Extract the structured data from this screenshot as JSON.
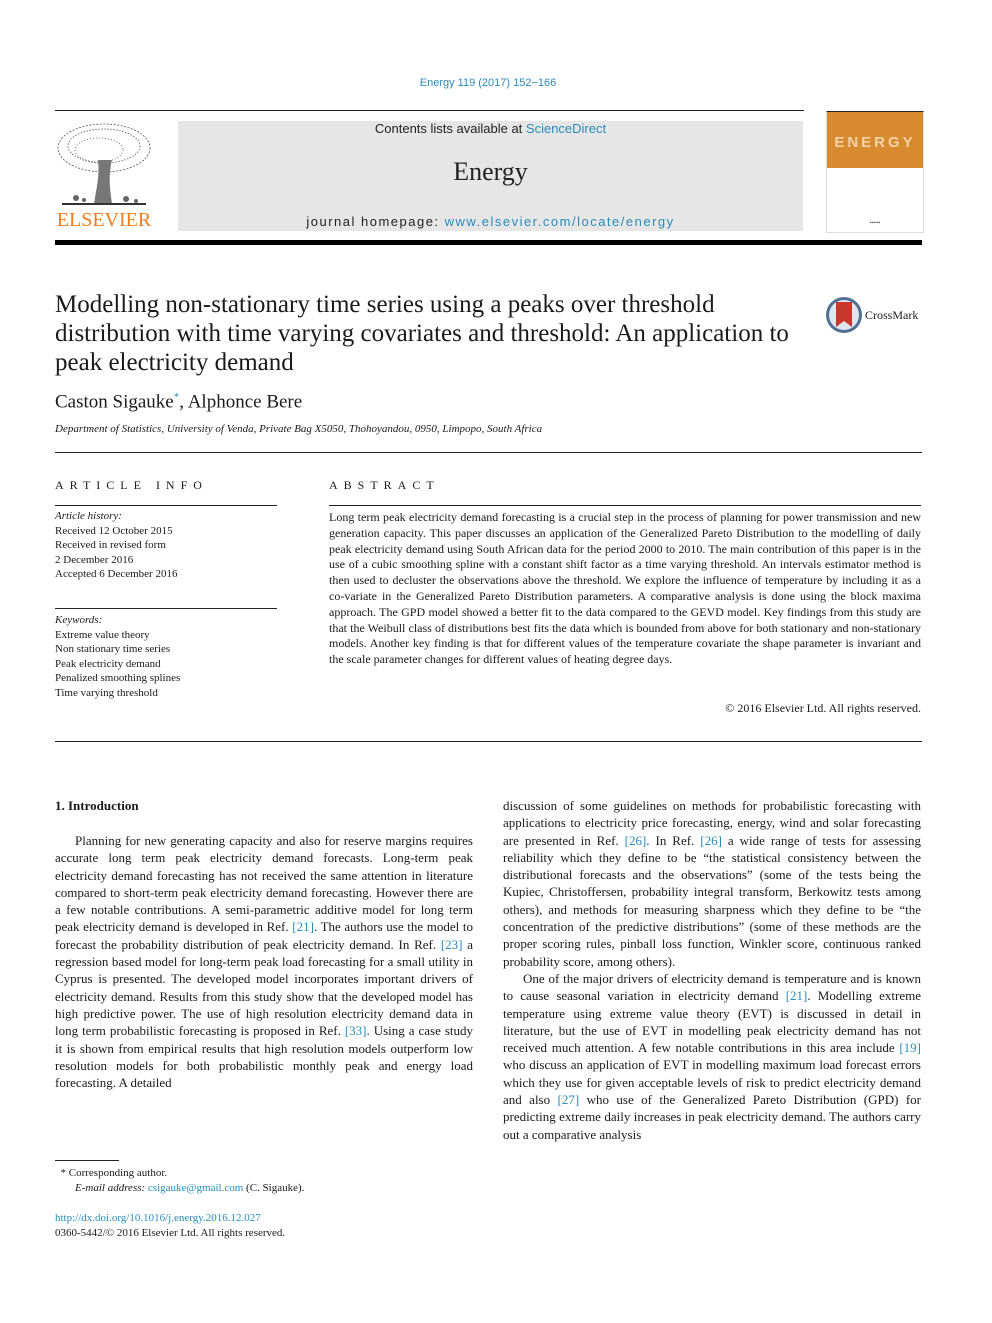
{
  "header": {
    "citation": "Energy 119 (2017) 152−166",
    "contents_prefix": "Contents lists available at ",
    "contents_link": "ScienceDirect",
    "journal_name": "Energy",
    "homepage_prefix": "journal homepage: ",
    "homepage_link": "www.elsevier.com/locate/energy",
    "publisher_logo": "ELSEVIER",
    "cover_title": "ENERGY",
    "crossmark_label": "CrossMark",
    "colors": {
      "link": "#2a8bb8",
      "elsevier_orange": "#f07d1b",
      "cover_orange": "#d88a2e",
      "banner_gray": "#e6e6e6"
    }
  },
  "article": {
    "title": "Modelling non-stationary time series using a peaks over threshold distribution with time varying covariates and threshold: An application to peak electricity demand",
    "author1": "Caston Sigauke",
    "author1_mark": "*",
    "author_sep": ", ",
    "author2": "Alphonce Bere",
    "affiliation": "Department of Statistics, University of Venda, Private Bag X5050, Thohoyandou, 0950, Limpopo, South Africa"
  },
  "article_info": {
    "heading": "ARTICLE INFO",
    "history_label": "Article history:",
    "history": [
      "Received 12 October 2015",
      "Received in revised form",
      "2 December 2016",
      "Accepted 6 December 2016"
    ],
    "keywords_label": "Keywords:",
    "keywords": [
      "Extreme value theory",
      "Non stationary time series",
      "Peak electricity demand",
      "Penalized smoothing splines",
      "Time varying threshold"
    ]
  },
  "abstract": {
    "heading": "ABSTRACT",
    "text": "Long term peak electricity demand forecasting is a crucial step in the process of planning for power transmission and new generation capacity. This paper discusses an application of the Generalized Pareto Distribution to the modelling of daily peak electricity demand using South African data for the period 2000 to 2010. The main contribution of this paper is in the use of a cubic smoothing spline with a constant shift factor as a time varying threshold. An intervals estimator method is then used to decluster the observations above the threshold. We explore the influence of temperature by including it as a co-variate in the Generalized Pareto Distribution parameters. A comparative analysis is done using the block maxima approach. The GPD model showed a better fit to the data compared to the GEVD model. Key findings from this study are that the Weibull class of distributions best fits the data which is bounded from above for both stationary and non-stationary models. Another key finding is that for different values of the temperature covariate the shape parameter is invariant and the scale parameter changes for different values of heating degree days.",
    "copyright": "© 2016 Elsevier Ltd. All rights reserved."
  },
  "introduction": {
    "heading": "1.  Introduction",
    "left_p1_a": "Planning for new generating capacity and also for reserve margins requires accurate long term peak electricity demand forecasts. Long-term peak electricity demand forecasting has not received the same attention in literature compared to short-term peak electricity demand forecasting. However there are a few notable contributions. A semi-parametric additive model for long term peak electricity demand is developed in Ref. ",
    "ref21": "[21]",
    "left_p1_b": ". The authors use the model to forecast the probability distribution of peak electricity demand. In Ref. ",
    "ref23": "[23]",
    "left_p1_c": " a regression based model for long-term peak load forecasting for a small utility in Cyprus is presented. The developed model incorporates important drivers of electricity demand. Results from this study show that the developed model has high predictive power. The use of high resolution electricity demand data in long term probabilistic forecasting is proposed in Ref. ",
    "ref33": "[33]",
    "left_p1_d": ". Using a case study it is shown from empirical results that high resolution models outperform low resolution models for both probabilistic monthly peak and energy load forecasting. A detailed",
    "right_p1_a": "discussion of some guidelines on methods for probabilistic forecasting with applications to electricity price forecasting, energy, wind and solar forecasting are presented in Ref. ",
    "ref26a": "[26]",
    "right_p1_b": ". In Ref. ",
    "ref26b": "[26]",
    "right_p1_c": " a wide range of tests for assessing reliability which they define to be “the statistical consistency between the distributional forecasts and the observations” (some of the tests being the Kupiec, Christoffersen, probability integral transform, Berkowitz tests among others), and methods for measuring sharpness which they define to be “the concentration of the predictive distributions” (some of these methods are the proper scoring rules, pinball loss function, Winkler score, continuous ranked probability score, among others).",
    "right_p2_a": "One of the major drivers of electricity demand is temperature and is known to cause seasonal variation in electricity demand ",
    "ref21b": "[21]",
    "right_p2_b": ". Modelling extreme temperature using extreme value theory (EVT) is discussed in detail in literature, but the use of EVT in modelling peak electricity demand has not received much attention. A few notable contributions in this area include ",
    "ref19": "[19]",
    "right_p2_c": " who discuss an application of EVT in modelling maximum load forecast errors which they use for given acceptable levels of risk to predict electricity demand and also ",
    "ref27": "[27]",
    "right_p2_d": " who use of the Generalized Pareto Distribution (GPD) for predicting extreme daily increases in peak electricity demand. The authors carry out a comparative analysis"
  },
  "footer": {
    "fn_mark": "*",
    "fn_corresponding": " Corresponding author.",
    "fn_email_label": "E-mail address: ",
    "fn_email": "csigauke@gmail.com",
    "fn_email_suffix": " (C. Sigauke).",
    "doi": "http://dx.doi.org/10.1016/j.energy.2016.12.027",
    "issn_line": "0360-5442/© 2016 Elsevier Ltd. All rights reserved."
  }
}
